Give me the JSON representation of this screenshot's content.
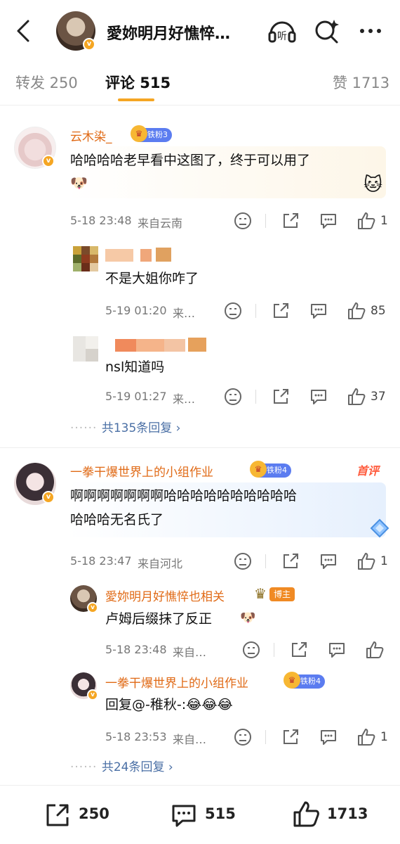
{
  "header": {
    "title": "愛妳明月好憔悴…"
  },
  "tabs": [
    {
      "label": "转发 250"
    },
    {
      "label": "评论 515"
    },
    {
      "label": "赞 1713"
    }
  ],
  "comments": [
    {
      "user": "云木染_",
      "badge": "铁粉3",
      "text": "哈哈哈哈老早看中这图了，终于可以用了",
      "time": "5-18 23:48",
      "location": "来自云南",
      "likes": "1",
      "replies": [
        {
          "user": "",
          "text": "不是大姐你咋了",
          "time": "5-19 01:20",
          "location": "来…",
          "likes": "85"
        },
        {
          "user": "",
          "text": "nsl知道吗",
          "time": "5-19 01:27",
          "location": "来…",
          "likes": "37"
        }
      ],
      "more": "共135条回复"
    },
    {
      "user": "一拳干爆世界上的小组作业",
      "badge": "铁粉4",
      "tag": "首评",
      "text_line1": "啊啊啊啊啊啊啊哈哈哈哈哈哈哈哈哈哈",
      "text_line2": "哈哈哈无名氏了",
      "time": "5-18 23:47",
      "location": "来自河北",
      "likes": "1",
      "replies": [
        {
          "user": "愛妳明月好憔悴也相关",
          "badge": "博主",
          "text": "卢姆后缀抹了反正",
          "time": "5-18 23:48",
          "location": "来自…",
          "likes": ""
        },
        {
          "user": "一拳干爆世界上的小组作业",
          "badge": "铁粉4",
          "text": "回复@-稚秋-:😂😂😂",
          "time": "5-18 23:53",
          "location": "来自…",
          "likes": "1"
        }
      ],
      "more": "共24条回复"
    }
  ],
  "bottom": {
    "repost": "250",
    "comment": "515",
    "like": "1713"
  },
  "colors": {
    "accent": "#f5a623",
    "username": "#e06a16",
    "link": "#4a6fa5",
    "badge": "#5b7cf0"
  }
}
